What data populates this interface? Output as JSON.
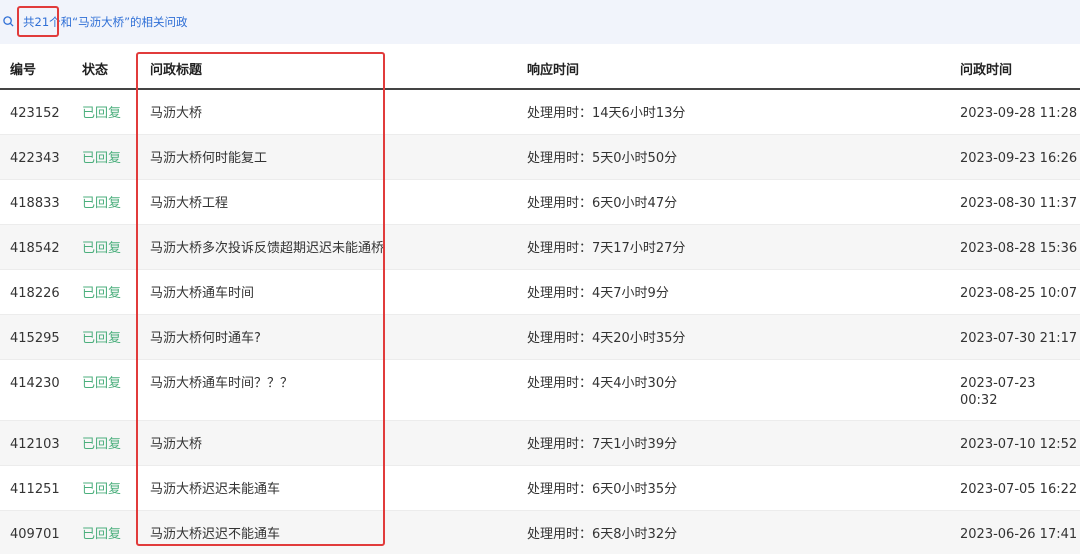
{
  "search": {
    "summary": "共21个和“马沥大桥”的相关问政"
  },
  "columns": {
    "id": "编号",
    "status": "状态",
    "title": "问政标题",
    "response": "响应时间",
    "time": "问政时间"
  },
  "rows": [
    {
      "id": "423152",
      "status": "已回复",
      "title": "马沥大桥",
      "response": "处理用时：14天6小时13分",
      "time": "2023-09-28 11:28"
    },
    {
      "id": "422343",
      "status": "已回复",
      "title": "马沥大桥何时能复工",
      "response": "处理用时：5天0小时50分",
      "time": "2023-09-23 16:26"
    },
    {
      "id": "418833",
      "status": "已回复",
      "title": "马沥大桥工程",
      "response": "处理用时：6天0小时47分",
      "time": "2023-08-30 11:37"
    },
    {
      "id": "418542",
      "status": "已回复",
      "title": "马沥大桥多次投诉反馈超期迟迟未能通桥",
      "response": "处理用时：7天17小时27分",
      "time": "2023-08-28 15:36"
    },
    {
      "id": "418226",
      "status": "已回复",
      "title": "马沥大桥通车时间",
      "response": "处理用时：4天7小时9分",
      "time": "2023-08-25 10:07"
    },
    {
      "id": "415295",
      "status": "已回复",
      "title": "马沥大桥何时通车?",
      "response": "处理用时：4天20小时35分",
      "time": "2023-07-30 21:17"
    },
    {
      "id": "414230",
      "status": "已回复",
      "title": "马沥大桥通车时间？？？",
      "response": "处理用时：4天4小时30分",
      "time": "2023-07-23 00:32"
    },
    {
      "id": "412103",
      "status": "已回复",
      "title": "马沥大桥",
      "response": "处理用时：7天1小时39分",
      "time": "2023-07-10 12:52"
    },
    {
      "id": "411251",
      "status": "已回复",
      "title": "马沥大桥迟迟未能通车",
      "response": "处理用时：6天0小时35分",
      "time": "2023-07-05 16:22"
    },
    {
      "id": "409701",
      "status": "已回复",
      "title": "马沥大桥迟迟不能通车",
      "response": "处理用时：6天8小时32分",
      "time": "2023-06-26 17:41"
    }
  ]
}
